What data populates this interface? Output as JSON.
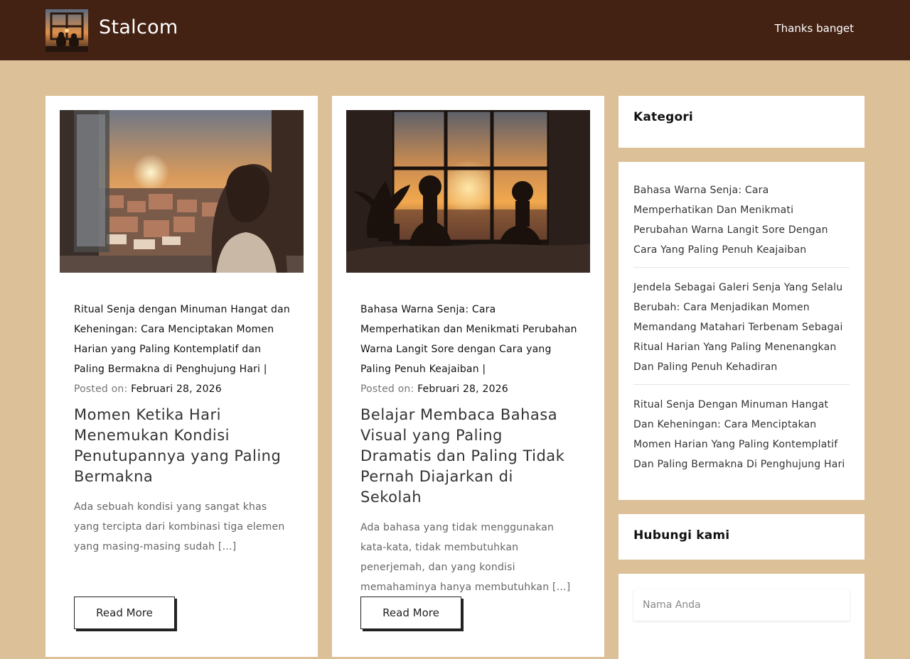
{
  "header": {
    "site_title": "Stalcom",
    "nav": [
      "Thanks banget"
    ],
    "bg_color": "#432214"
  },
  "posts": [
    {
      "category": "Ritual Senja dengan Minuman Hangat dan Keheningan: Cara Menciptakan Momen Harian yang Paling Kontemplatif dan Paling Bermakna di Penghujung Hari |",
      "posted_label": "Posted on:",
      "date": "Februari 28, 2026",
      "title": "Momen Ketika Hari Menemukan Kondisi Penutupannya yang Paling Bermakna",
      "excerpt": "Ada sebuah kondisi yang sangat khas yang tercipta dari kombinasi tiga elemen yang masing-masing sudah […]",
      "read_more": "Read More"
    },
    {
      "category": "Bahasa Warna Senja: Cara Memperhatikan dan Menikmati Perubahan Warna Langit Sore dengan Cara yang Paling Penuh Keajaiban |",
      "posted_label": "Posted on:",
      "date": "Februari 28, 2026",
      "title": "Belajar Membaca Bahasa Visual yang Paling Dramatis dan Paling Tidak Pernah Diajarkan di Sekolah",
      "excerpt": "Ada bahasa yang tidak menggunakan kata-kata, tidak membutuhkan penerjemah, dan yang kondisi memahaminya hanya membutuhkan […]",
      "read_more": "Read More"
    }
  ],
  "sidebar": {
    "kategori_title": "Kategori",
    "kategori_items": [
      "Bahasa Warna Senja: Cara Memperhatikan Dan Menikmati Perubahan Warna Langit Sore Dengan Cara Yang Paling Penuh Keajaiban",
      "Jendela Sebagai Galeri Senja Yang Selalu Berubah: Cara Menjadikan Momen Memandang Matahari Terbenam Sebagai Ritual Harian Yang Paling Menenangkan Dan Paling Penuh Kehadiran",
      "Ritual Senja Dengan Minuman Hangat Dan Keheningan: Cara Menciptakan Momen Harian Yang Paling Kontemplatif Dan Paling Bermakna Di Penghujung Hari"
    ],
    "contact_title": "Hubungi kami",
    "name_placeholder": "Nama Anda"
  },
  "colors": {
    "page_bg": "#dcc198",
    "card_bg": "#ffffff"
  }
}
